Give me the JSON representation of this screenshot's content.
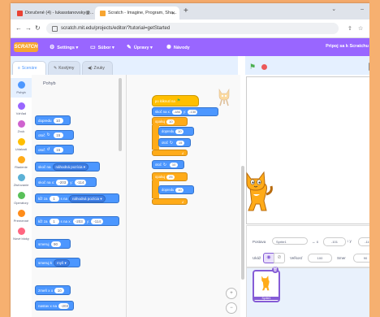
{
  "browser": {
    "tabs": [
      {
        "label": "Doručené (4) - lukasstanovsky@...",
        "favicon_color": "#ea4335"
      },
      {
        "label": "Scratch - Imagine, Program, Sha...",
        "favicon_color": "#f7a531"
      }
    ],
    "new_tab": "+",
    "url": "scratch.mit.edu/projects/editor/?tutorial=getStarted"
  },
  "menu": {
    "logo": "SCRATCH",
    "items": [
      {
        "label": "Settings",
        "icon": "globe-icon"
      },
      {
        "label": "Súbor",
        "icon": "file-icon"
      },
      {
        "label": "Úpravy",
        "icon": "pencil-icon"
      },
      {
        "label": "Návody",
        "icon": "lightbulb-icon"
      }
    ],
    "join": "Pripoj sa k Scratchu"
  },
  "editor_tabs": [
    "Scenáre",
    "Kostýmy",
    "Zvuky"
  ],
  "categories": [
    {
      "label": "Pohyb",
      "color": "#4c97ff"
    },
    {
      "label": "Vzhľad",
      "color": "#9966ff"
    },
    {
      "label": "Zvuk",
      "color": "#cf63cf"
    },
    {
      "label": "Udalosti",
      "color": "#ffbf00"
    },
    {
      "label": "Riadenie",
      "color": "#ffab19"
    },
    {
      "label": "Zisťovanie",
      "color": "#5cb1d6"
    },
    {
      "label": "Operátory",
      "color": "#59c059"
    },
    {
      "label": "Premenné",
      "color": "#ff8c1a"
    },
    {
      "label": "Nové bloky",
      "color": "#ff6680"
    }
  ],
  "palette": {
    "heading": "Pohyb",
    "blocks": [
      {
        "text": "dopredu",
        "value": "10"
      },
      {
        "text": "otoč",
        "value": "15"
      },
      {
        "text": "otoč",
        "value": "15"
      },
      {
        "text": "skoč na",
        "dropdown": "náhodná pozícia"
      },
      {
        "text": "skoč na x:",
        "value": "-203",
        "text2": "y:",
        "value2": "-114"
      },
      {
        "text": "kĺž za",
        "value": "1",
        "text2": "s na",
        "dropdown": "náhodná pozícia"
      },
      {
        "text": "kĺž za",
        "value": "1",
        "text2": "s na x:",
        "value2": "-203",
        "text3": "y:",
        "value3": "-114"
      },
      {
        "text": "smeruj",
        "value": "90"
      },
      {
        "text": "smeruj k",
        "dropdown": "myš"
      },
      {
        "text": "zmeň x o",
        "value": "10"
      },
      {
        "text": "nastav x na",
        "value": "-203"
      }
    ]
  },
  "script": {
    "hat": "po kliknutí na",
    "blocks": [
      {
        "text": "skoč na x:",
        "value": "-186",
        "text2": "y:",
        "value2": "-130"
      },
      {
        "text": "opakuj",
        "value": "10"
      },
      {
        "text": "dopredu",
        "value": "10"
      },
      {
        "text": "otoč",
        "value": "15"
      },
      {
        "text": "opakuj",
        "value": "25"
      },
      {
        "text": "dopredu",
        "value": "10"
      }
    ]
  },
  "sprite_info": {
    "sprite_label": "Postava",
    "sprite_name": "Sprite1",
    "x_label": "x",
    "x": "-101",
    "y_label": "y",
    "y": "-119",
    "show_label": "Ukáž",
    "size_label": "Veľkosť",
    "size": "100",
    "direction_label": "Smer",
    "direction": "90"
  },
  "sprite_thumb": "Sprite1"
}
